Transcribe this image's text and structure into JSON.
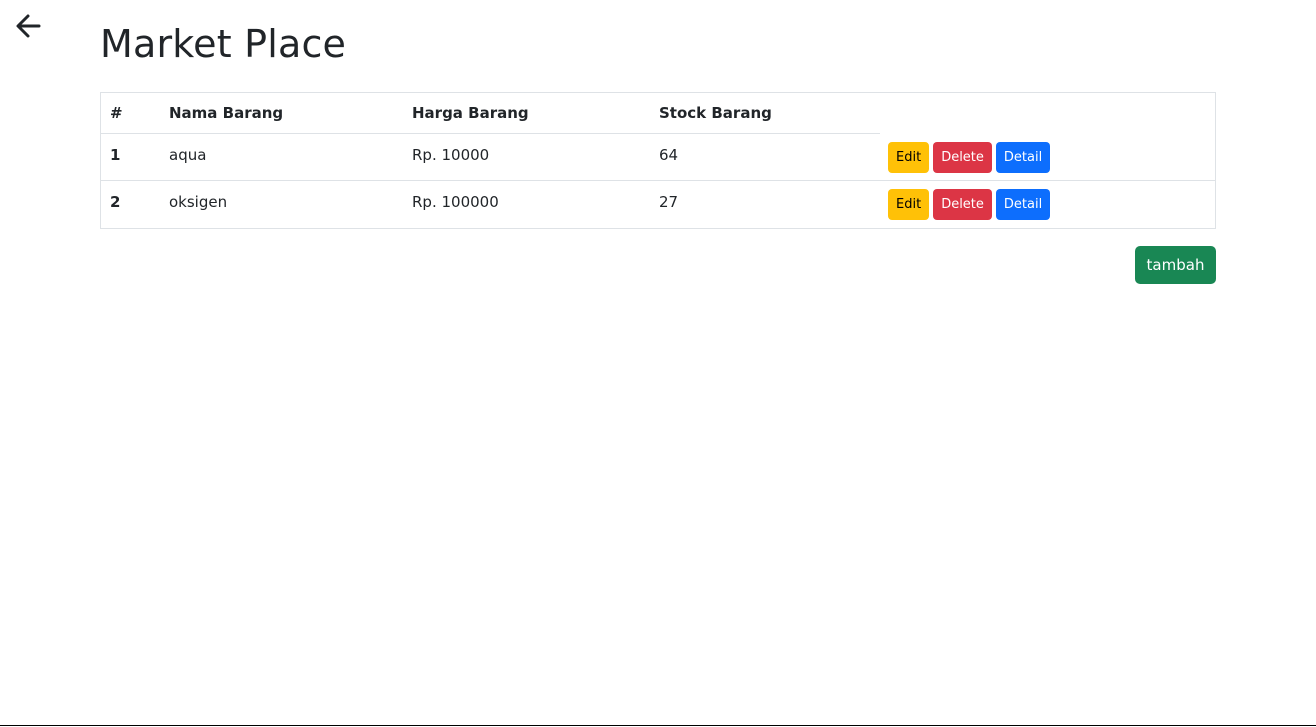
{
  "header": {
    "back_icon": "arrow-left-icon",
    "title": "Market Place"
  },
  "table": {
    "columns": [
      "#",
      "Nama Barang",
      "Harga Barang",
      "Stock Barang"
    ],
    "rows": [
      {
        "no": "1",
        "name": "aqua",
        "price": "Rp. 10000",
        "stock": "64",
        "edit_label": "Edit",
        "delete_label": "Delete",
        "detail_label": "Detail"
      },
      {
        "no": "2",
        "name": "oksigen",
        "price": "Rp. 100000",
        "stock": "27",
        "edit_label": "Edit",
        "delete_label": "Delete",
        "detail_label": "Detail"
      }
    ]
  },
  "actions": {
    "add_label": "tambah"
  },
  "colors": {
    "edit": "#ffc107",
    "delete": "#dc3545",
    "detail": "#0d6efd",
    "add": "#198754"
  }
}
